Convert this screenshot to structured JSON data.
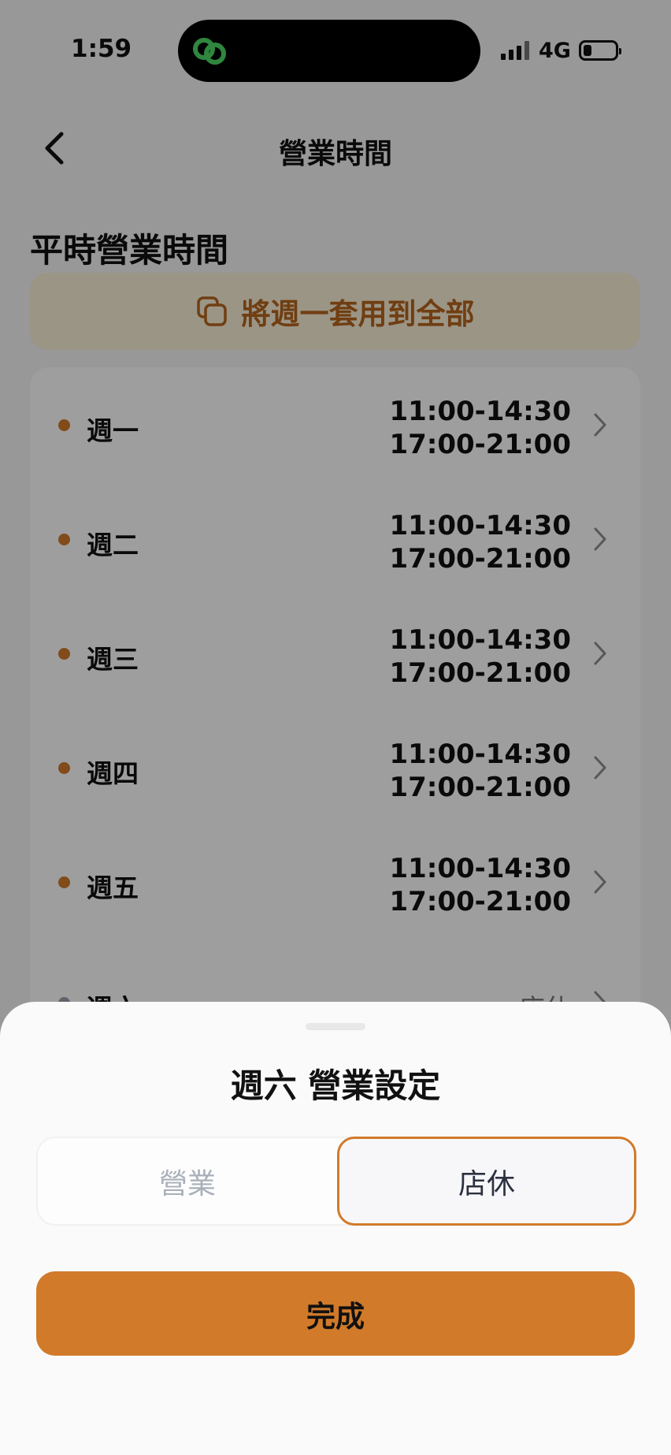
{
  "status_bar": {
    "time": "1:59",
    "network": "4G",
    "island_icon": "link-icon",
    "island_icon_color": "#4cd964"
  },
  "header": {
    "back_icon": "chevron-left-icon",
    "title": "營業時間"
  },
  "section": {
    "title": "平時營業時間"
  },
  "copy_button": {
    "icon": "copy-icon",
    "label": "將週一套用到全部",
    "color": "#b5651d"
  },
  "days": [
    {
      "label": "週一",
      "status": "open",
      "slot1": "11:00-14:30",
      "slot2": "17:00-21:00"
    },
    {
      "label": "週二",
      "status": "open",
      "slot1": "11:00-14:30",
      "slot2": "17:00-21:00"
    },
    {
      "label": "週三",
      "status": "open",
      "slot1": "11:00-14:30",
      "slot2": "17:00-21:00"
    },
    {
      "label": "週四",
      "status": "open",
      "slot1": "11:00-14:30",
      "slot2": "17:00-21:00"
    },
    {
      "label": "週五",
      "status": "open",
      "slot1": "11:00-14:30",
      "slot2": "17:00-21:00"
    },
    {
      "label": "週六",
      "status": "closed",
      "closed_label": "店休"
    }
  ],
  "colors": {
    "accent": "#d17a2a",
    "open_dot": "#d17a2a",
    "closed_dot": "#9aa0ab"
  },
  "sheet": {
    "title": "週六 營業設定",
    "option_open": "營業",
    "option_closed": "店休",
    "selected": "店休",
    "done_label": "完成"
  }
}
